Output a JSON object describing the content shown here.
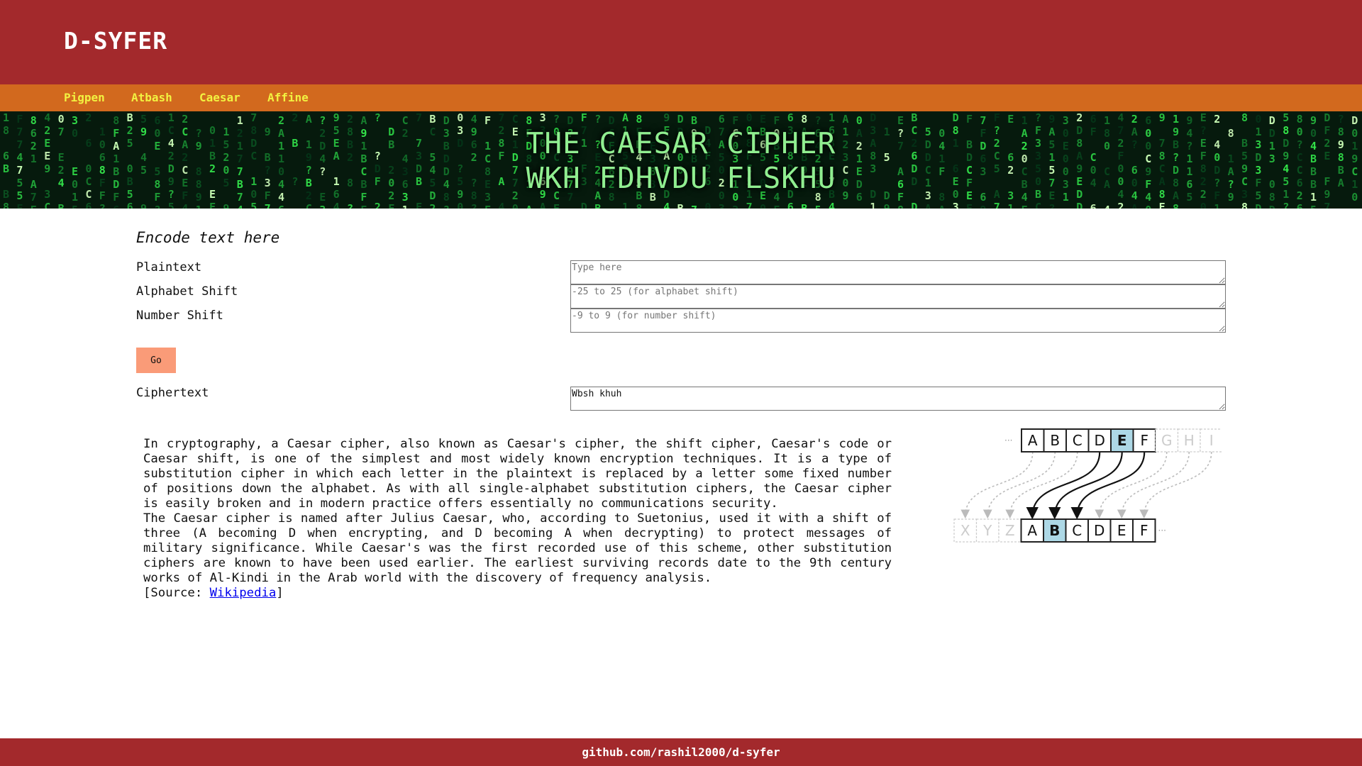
{
  "app": {
    "brand": "D-SYFER"
  },
  "nav": {
    "items": [
      {
        "label": "Pigpen"
      },
      {
        "label": "Atbash"
      },
      {
        "label": "Caesar"
      },
      {
        "label": "Affine"
      }
    ]
  },
  "banner": {
    "title": "THE CAESAR CIPHER",
    "subtitle": "WKH FDHVDU FLSKHU"
  },
  "form": {
    "heading": "Encode text here",
    "plaintext": {
      "label": "Plaintext",
      "placeholder": "Type here",
      "value": ""
    },
    "alphabet_shift": {
      "label": "Alphabet Shift",
      "placeholder": "-25 to 25 (for alphabet shift)",
      "value": ""
    },
    "number_shift": {
      "label": "Number Shift",
      "placeholder": "-9 to 9 (for number shift)",
      "value": ""
    },
    "go_label": "Go",
    "ciphertext": {
      "label": "Ciphertext",
      "value": "Wbsh khuh"
    }
  },
  "description": {
    "paragraph1": "In cryptography, a Caesar cipher, also known as Caesar's cipher, the shift cipher, Caesar's code or Caesar shift, is one of the simplest and most widely known encryption techniques. It is a type of substitution cipher in which each letter in the plaintext is replaced by a letter some fixed number of positions down the alphabet. As with all single-alphabet substitution ciphers, the Caesar cipher is easily broken and in modern practice offers essentially no communications security.",
    "paragraph2": "The Caesar cipher is named after Julius Caesar, who, according to Suetonius, used it with a shift of three (A becoming D when encrypting, and D becoming A when decrypting) to protect messages of military significance. While Caesar's was the first recorded use of this scheme, other substitution ciphers are known to have been used earlier. The earliest surviving records date to the 9th century works of Al-Kindi in the Arab world with the discovery of frequency analysis.",
    "source_prefix": "[Source: ",
    "source_link": "Wikipedia",
    "source_suffix": "]"
  },
  "diagram": {
    "top_letters": [
      "A",
      "B",
      "C",
      "D",
      "E",
      "F",
      "G",
      "H",
      "I"
    ],
    "bottom_letters": [
      "X",
      "Y",
      "Z",
      "A",
      "B",
      "C",
      "D",
      "E",
      "F"
    ],
    "ellipsis": "···",
    "highlight_color": "#add8e6"
  },
  "footer": {
    "text": "github.com/rashil2000/d-syfer"
  },
  "colors": {
    "topbar": "#a3292c",
    "navbar": "#d2691e",
    "nav_text": "#f2f240",
    "banner_text": "#90ee90",
    "go_button": "#fa9b78"
  }
}
